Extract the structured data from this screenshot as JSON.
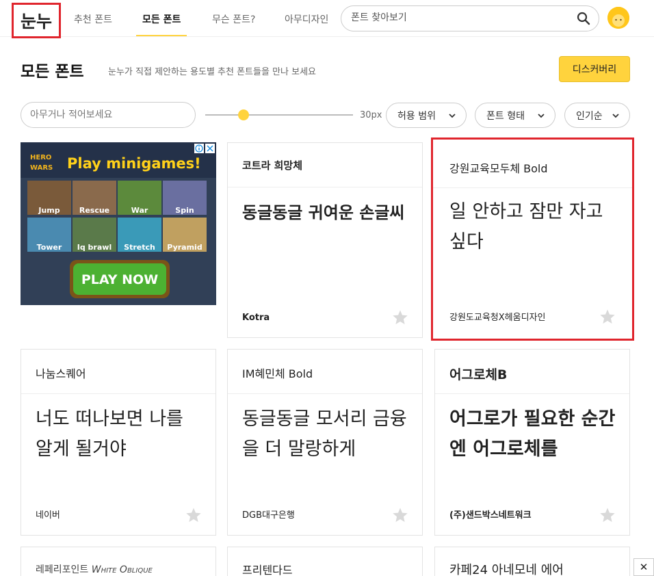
{
  "header": {
    "logo": "눈누",
    "nav": [
      {
        "label": "추천 폰트"
      },
      {
        "label": "모든 폰트"
      },
      {
        "label": "무슨 폰트?"
      },
      {
        "label": "아무디자인"
      }
    ],
    "search_placeholder": "폰트 찾아보기"
  },
  "title_row": {
    "title": "모든 폰트",
    "subtitle": "눈누가 직접 제안하는 용도별 추천 폰트들을 만나 보세요",
    "discover_button": "디스커버리"
  },
  "filters": {
    "sample_placeholder": "아무거나 적어보세요",
    "size_label": "30px",
    "font_size": 30,
    "license": "허용 범위",
    "shape": "폰트 형태",
    "sort": "인기순"
  },
  "ad": {
    "brand_top": "HERO",
    "brand_bottom": "WARS",
    "headline": "Play minigames!",
    "tiles": [
      "Jump",
      "Rescue",
      "War",
      "Spin",
      "Tower",
      "Iq brawl",
      "Stretch",
      "Pyramid"
    ],
    "cta": "PLAY NOW",
    "info_icon": "info-icon",
    "close_icon": "close-icon"
  },
  "cards": [
    {
      "name": "코트라 희망체",
      "sample": "동글동글 귀여운 손글씨",
      "maker": "Kotra",
      "starred": false
    },
    {
      "name": "강원교육모두체 Bold",
      "sample": "일 안하고 잠만 자고 싶다",
      "maker": "강원도교육청X헤움디자인",
      "starred": false
    },
    {
      "name": "나눔스퀘어",
      "sample": "너도 떠나보면 나를 알게 될거야",
      "maker": "네이버",
      "starred": false
    },
    {
      "name": "IM혜민체 Bold",
      "sample": "동글동글 모서리 금융을 더 말랑하게",
      "maker": "DGB대구은행",
      "starred": false
    },
    {
      "name": "어그로체B",
      "sample": "어그로가 필요한 순간엔 어그로체를",
      "maker": "(주)샌드박스네트워크",
      "starred": false
    },
    {
      "name_prefix": "레페리포인트",
      "name_suffix": "White Oblique"
    },
    {
      "name": "프리텐다드"
    },
    {
      "name": "카페24 아네모네 에어"
    }
  ],
  "colors": {
    "accent": "#ffd33d",
    "highlight": "#e0252d",
    "star": "#d9d9d9"
  },
  "close_button": "✕"
}
